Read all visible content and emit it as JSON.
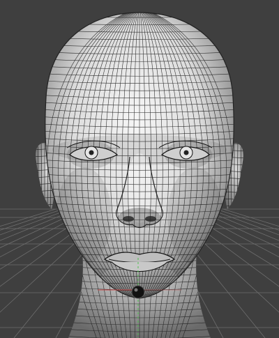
{
  "viewport": {
    "view": "front",
    "shading": "wireframe-on-shaded",
    "colors": {
      "background": "#3f3f3f",
      "grid": "#6e6e6e",
      "wire": "#1a1a1a",
      "skin_light": "#f2f2f2",
      "skin_mid": "#b5b5b5",
      "skin_dark": "#4a4a4a",
      "axis_x": "#c84848",
      "axis_y": "#4fbf4f"
    },
    "model": {
      "object": "head-mesh",
      "manipulator": "pivot-gizmo"
    }
  }
}
